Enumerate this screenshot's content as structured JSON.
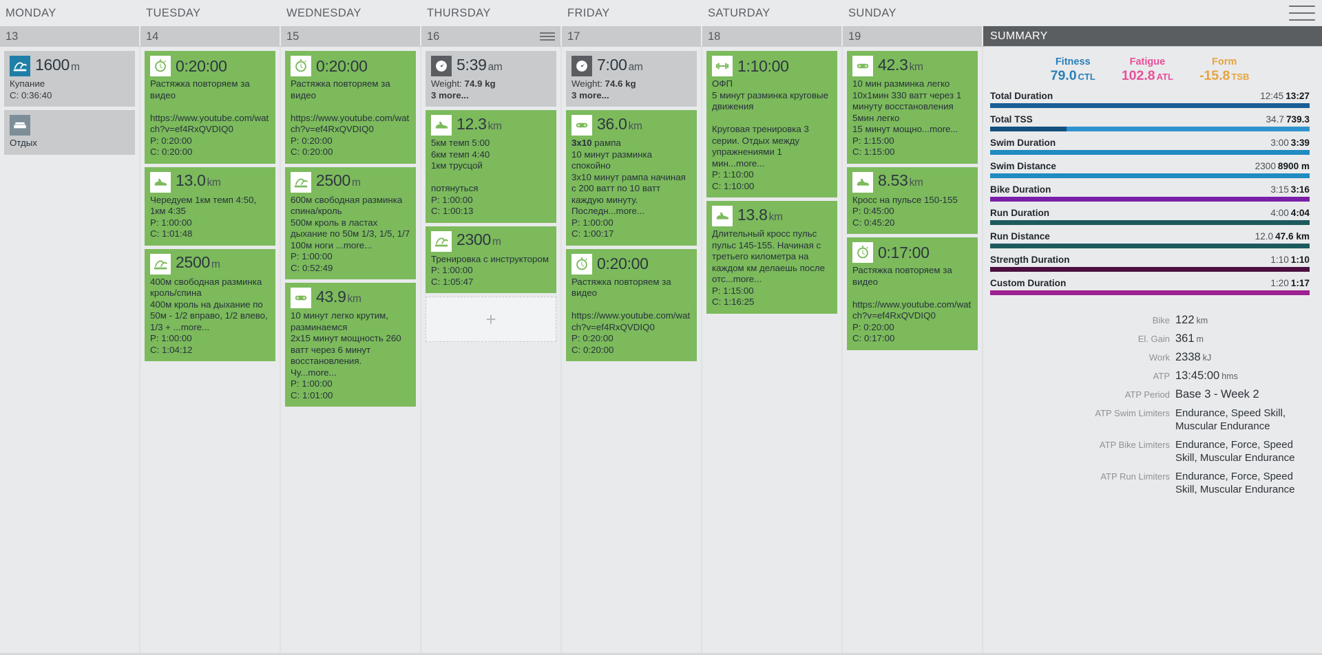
{
  "colors": {
    "workout_green": "#7cba5c",
    "gray_card": "#c8cacc",
    "swim_blue": "#1f7fa8",
    "rest_slate": "#7d8e98",
    "fitness": "#2a7fb8",
    "fatigue": "#e8509a",
    "form": "#e8a33d",
    "bar_total_duration": "#1a5e96",
    "bar_total_tss_a": "#14507f",
    "bar_total_tss_b": "#2f93cf",
    "bar_swim": "#1f8bc0",
    "bar_bike": "#7a1fa8",
    "bar_run": "#1d5a5e",
    "bar_strength": "#4b1040",
    "bar_custom": "#9d2191"
  },
  "header": {
    "days": [
      "MONDAY",
      "TUESDAY",
      "WEDNESDAY",
      "THURSDAY",
      "FRIDAY",
      "SATURDAY",
      "SUNDAY"
    ],
    "dates": [
      "13",
      "14",
      "15",
      "16",
      "17",
      "18",
      "19"
    ],
    "summary_tab_label": "SUMMARY",
    "menu_icon": "hamburger-icon",
    "day_menu_icon": "day-options-icon"
  },
  "add_card_label": "+",
  "days": [
    {
      "date": "13",
      "cards": [
        {
          "style": "gray",
          "icon": "swim-icon",
          "icon_bg": "blue",
          "headline": "1600",
          "unit": "m",
          "body": "Купание\nC: 0:36:40"
        },
        {
          "style": "rest",
          "icon": "rest-bed-icon",
          "icon_bg": "slate",
          "headline": "",
          "unit": "",
          "body": "Отдых"
        }
      ]
    },
    {
      "date": "14",
      "cards": [
        {
          "style": "green",
          "icon": "stopwatch-icon",
          "icon_bg": "white",
          "headline": "0:20:00",
          "unit": "",
          "body": "Растяжка повторяем за видео\n\nhttps://www.youtube.com/watch?v=ef4RxQVDIQ0\nP: 0:20:00\nC: 0:20:00"
        },
        {
          "style": "green",
          "icon": "run-shoe-icon",
          "icon_bg": "white",
          "headline": "13.0",
          "unit": "km",
          "body": "Чередуем 1км темп 4:50, 1км 4:35\nP: 1:00:00\nC: 1:01:48"
        },
        {
          "style": "green",
          "icon": "swim-icon",
          "icon_bg": "white",
          "headline": "2500",
          "unit": "m",
          "body": "400м свободная разминка кроль/спина\n400м кроль на дыхание по 50м - 1/2 вправо, 1/2 влево, 1/3 + ...more...\nP: 1:00:00\nC: 1:04:12"
        }
      ]
    },
    {
      "date": "15",
      "cards": [
        {
          "style": "green",
          "icon": "stopwatch-icon",
          "icon_bg": "white",
          "headline": "0:20:00",
          "unit": "",
          "body": "Растяжка повторяем за видео\n\nhttps://www.youtube.com/watch?v=ef4RxQVDIQ0\nP: 0:20:00\nC: 0:20:00"
        },
        {
          "style": "green",
          "icon": "swim-icon",
          "icon_bg": "white",
          "headline": "2500",
          "unit": "m",
          "body": "600м свободная разминка спина/кроль\n500м кроль в ластах дыхание по 50м 1/3, 1/5, 1/7\n100м ноги ...more...\nP: 1:00:00\nC: 0:52:49"
        },
        {
          "style": "green",
          "icon": "bike-chain-icon",
          "icon_bg": "white",
          "headline": "43.9",
          "unit": "km",
          "body": "10 минут легко крутим, разминаемся\n2х15 минут мощность 260 ватт через 6 минут восстановления.\nЧу...more...\nP: 1:00:00\nC: 1:01:00"
        }
      ]
    },
    {
      "date": "16",
      "cards": [
        {
          "style": "gray",
          "icon": "weight-scale-icon",
          "icon_bg": "dkgray",
          "headline": "5:39",
          "unit": "am",
          "body_html": "Weight: <b>74.9 kg</b>\n<b>3 more...</b>"
        },
        {
          "style": "green",
          "icon": "run-shoe-icon",
          "icon_bg": "white",
          "headline": "12.3",
          "unit": "km",
          "body": "5км темп 5:00\n6км темп 4:40\n1км трусцой\n\nпотянуться\nP: 1:00:00\nC: 1:00:13"
        },
        {
          "style": "green",
          "icon": "swim-icon",
          "icon_bg": "white",
          "headline": "2300",
          "unit": "m",
          "body": "Тренировка с инструктором\nP: 1:00:00\nC: 1:05:47"
        },
        {
          "style": "add",
          "icon": "plus-icon"
        }
      ]
    },
    {
      "date": "17",
      "cards": [
        {
          "style": "gray",
          "icon": "weight-scale-icon",
          "icon_bg": "dkgray",
          "headline": "7:00",
          "unit": "am",
          "body_html": "Weight: <b>74.6 kg</b>\n<b>3 more...</b>"
        },
        {
          "style": "green",
          "icon": "bike-chain-icon",
          "icon_bg": "white",
          "headline": "36.0",
          "unit": "km",
          "body_html": "<b>3x10</b> рампа\n10 минут разминка спокойно\n3х10 минут рампа начиная с 200 ватт по 10 ватт каждую минуту. Последн...more...\nP: 1:00:00\nC: 1:00:17"
        },
        {
          "style": "green",
          "icon": "stopwatch-icon",
          "icon_bg": "white",
          "headline": "0:20:00",
          "unit": "",
          "body": "Растяжка повторяем за видео\n\nhttps://www.youtube.com/watch?v=ef4RxQVDIQ0\nP: 0:20:00\nC: 0:20:00"
        }
      ]
    },
    {
      "date": "18",
      "cards": [
        {
          "style": "green",
          "icon": "strength-dumbbell-icon",
          "icon_bg": "white",
          "headline": "1:10:00",
          "unit": "",
          "body": "ОФП\n5 минут разминка круговые движения\n\nКруговая тренировка 3 серии. Отдых между упражнениями 1 мин...more...\nP: 1:10:00\nC: 1:10:00"
        },
        {
          "style": "green",
          "icon": "run-shoe-icon",
          "icon_bg": "white",
          "headline": "13.8",
          "unit": "km",
          "body": "Длительный кросс пульс пульс 145-155. Начиная с третьего километра на каждом км делаешь после отс...more...\nP: 1:15:00\nC: 1:16:25"
        }
      ]
    },
    {
      "date": "19",
      "cards": [
        {
          "style": "green",
          "icon": "bike-chain-icon",
          "icon_bg": "white",
          "headline": "42.3",
          "unit": "km",
          "body": "10 мин разминка легко\n10х1мин 330 ватт через 1 минуту восстановления\n5мин легко\n15 минут мощно...more...\nP: 1:15:00\nC: 1:15:00"
        },
        {
          "style": "green",
          "icon": "run-shoe-icon",
          "icon_bg": "white",
          "headline": "8.53",
          "unit": "km",
          "body": "Кросс на пульсе 150-155\nP: 0:45:00\nC: 0:45:20"
        },
        {
          "style": "green",
          "icon": "stopwatch-icon",
          "icon_bg": "white",
          "headline": "0:17:00",
          "unit": "",
          "body": "Растяжка повторяем за видео\n\nhttps://www.youtube.com/watch?v=ef4RxQVDIQ0\nP: 0:20:00\nC: 0:17:00"
        }
      ]
    }
  ],
  "summary": {
    "pmc": [
      {
        "label": "Fitness",
        "value": "79.0",
        "suffix": "CTL",
        "color": "#2a7fb8"
      },
      {
        "label": "Fatigue",
        "value": "102.8",
        "suffix": "ATL",
        "color": "#e8509a"
      },
      {
        "label": "Form",
        "value": "-15.8",
        "suffix": "TSB",
        "color": "#e8a33d"
      }
    ],
    "metrics": [
      {
        "name": "Total Duration",
        "planned": "12:45",
        "done": "13:27",
        "pct": 100,
        "color": "#1a5e96",
        "split": false
      },
      {
        "name": "Total TSS",
        "planned": "34.7",
        "done": "739.3",
        "pct": 100,
        "color": "#2f93cf",
        "split": true,
        "split_pct": 24,
        "split_color": "#14507f"
      },
      {
        "name": "Swim Duration",
        "planned": "3:00",
        "done": "3:39",
        "pct": 100,
        "color": "#1f8bc0",
        "split": false
      },
      {
        "name": "Swim Distance",
        "planned": "2300",
        "done": "8900 m",
        "pct": 100,
        "color": "#1f8bc0",
        "split": false
      },
      {
        "name": "Bike Duration",
        "planned": "3:15",
        "done": "3:16",
        "pct": 100,
        "color": "#7a1fa8",
        "split": false
      },
      {
        "name": "Run Duration",
        "planned": "4:00",
        "done": "4:04",
        "pct": 100,
        "color": "#1d5a5e",
        "split": false
      },
      {
        "name": "Run Distance",
        "planned": "12.0",
        "done": "47.6 km",
        "pct": 100,
        "color": "#1d5a5e",
        "split": false
      },
      {
        "name": "Strength Duration",
        "planned": "1:10",
        "done": "1:10",
        "pct": 100,
        "color": "#4b1040",
        "split": false
      },
      {
        "name": "Custom Duration",
        "planned": "1:20",
        "done": "1:17",
        "pct": 100,
        "color": "#9d2191",
        "split": false
      }
    ],
    "atp": [
      {
        "label": "Bike",
        "value": "122",
        "unit": "km"
      },
      {
        "label": "El. Gain",
        "value": "361",
        "unit": "m"
      },
      {
        "label": "Work",
        "value": "2338",
        "unit": "kJ"
      },
      {
        "label": "ATP",
        "value": "13:45:00",
        "unit": "hms"
      },
      {
        "label": "ATP Period",
        "value": "Base 3 - Week 2",
        "unit": ""
      },
      {
        "label": "ATP Swim Limiters",
        "value": "Endurance, Speed Skill, Muscular Endurance",
        "unit": ""
      },
      {
        "label": "ATP Bike Limiters",
        "value": "Endurance, Force, Speed Skill, Muscular Endurance",
        "unit": ""
      },
      {
        "label": "ATP Run Limiters",
        "value": "Endurance, Force, Speed Skill, Muscular Endurance",
        "unit": ""
      }
    ]
  }
}
